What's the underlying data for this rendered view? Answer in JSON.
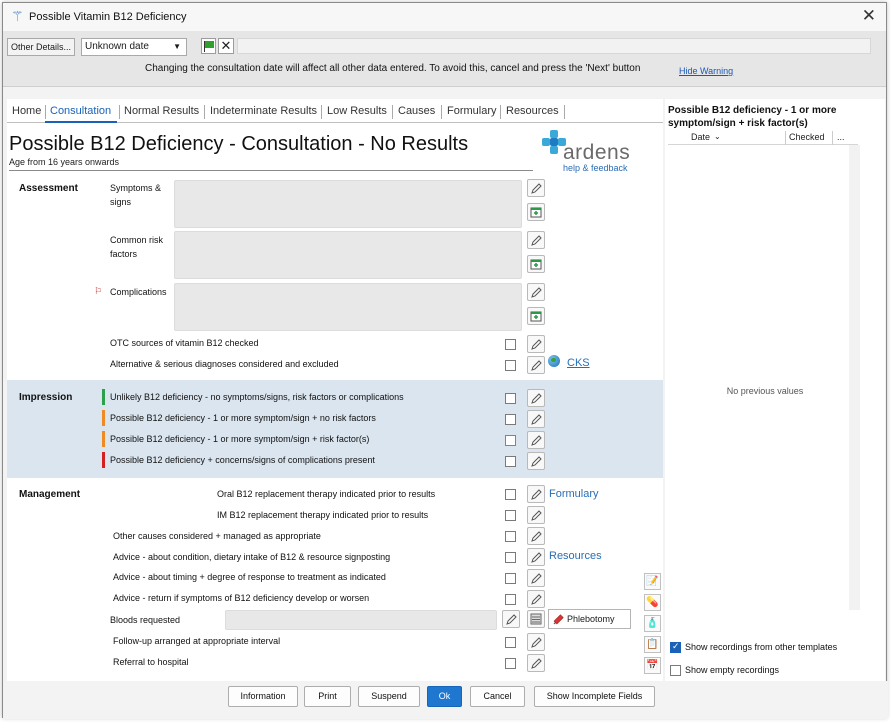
{
  "window": {
    "title": "Possible Vitamin B12 Deficiency"
  },
  "toolbar": {
    "other_details_label": "Other Details...",
    "date_value": "Unknown date",
    "warning": "Changing the consultation date will affect all other data entered. To avoid this, cancel and press the 'Next' button",
    "hide_warning": "Hide Warning"
  },
  "tabs": [
    "Home",
    "Consultation",
    "Normal Results",
    "Indeterminate Results",
    "Low Results",
    "Causes",
    "Formulary",
    "Resources"
  ],
  "header": {
    "title": "Possible B12 Deficiency - Consultation - No Results",
    "subtitle": "Age from 16 years onwards",
    "logo_text": "ardens",
    "help_link": "help & feedback"
  },
  "assessment": {
    "label": "Assessment",
    "symptoms": "Symptoms &\nsigns",
    "risk_factors": "Common risk\nfactors",
    "complications": "Complications",
    "otc": "OTC sources of vitamin B12 checked",
    "alternative": "Alternative & serious diagnoses considered and excluded",
    "cks_link": "CKS"
  },
  "impression": {
    "label": "Impression",
    "items": [
      "Unlikely B12 deficiency - no symptoms/signs, risk factors or complications",
      "Possible B12 deficiency - 1 or more symptom/sign + no risk factors",
      "Possible B12 deficiency - 1 or more symptom/sign + risk factor(s)",
      "Possible B12 deficiency + concerns/signs of complications present"
    ],
    "bar_colors": [
      "#2aa14a",
      "#f08a24",
      "#f08a24",
      "#d32020"
    ]
  },
  "management": {
    "label": "Management",
    "oral": "Oral B12 replacement therapy indicated prior to results",
    "im": "IM B12 replacement therapy indicated prior to results",
    "other_causes": "Other causes considered + managed as appropriate",
    "advice_condition": "Advice - about condition, dietary intake of B12 & resource signposting",
    "advice_timing": "Advice - about timing + degree of response to treatment as indicated",
    "advice_return": "Advice - return if symptoms of B12 deficiency develop or worsen",
    "bloods": "Bloods requested",
    "follow_up": "Follow-up arranged at appropriate interval",
    "referral": "Referral to hospital",
    "formulary_link": "Formulary",
    "resources_link": "Resources",
    "phlebotomy": "Phlebotomy"
  },
  "right_panel": {
    "title": "Possible B12 deficiency - 1 or more symptom/sign + risk factor(s)",
    "col_date": "Date",
    "col_checked": "Checked",
    "col_more": "...",
    "empty": "No previous values",
    "show_other": "Show recordings from other templates",
    "show_empty": "Show empty recordings"
  },
  "footer": {
    "information": "Information",
    "print": "Print",
    "suspend": "Suspend",
    "ok": "Ok",
    "cancel": "Cancel",
    "incomplete": "Show Incomplete Fields"
  }
}
